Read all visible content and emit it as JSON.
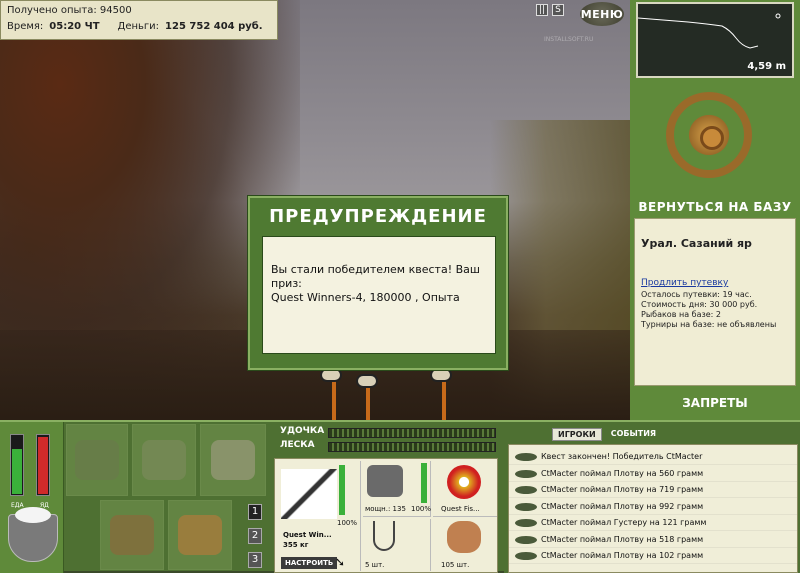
{
  "stats": {
    "experience_label": "Получено опыта: 94500",
    "time_label": "Время:",
    "time_value": "05:20 ЧТ",
    "money_label": "Деньги:",
    "money_value": "125 752 404 руб."
  },
  "top": {
    "pause_icon": "pause-icon",
    "sound_label": "S",
    "menu_label": "МЕНЮ",
    "watermark": "INSTALLSOFT.RU"
  },
  "depth": {
    "value": "4,59 m"
  },
  "right": {
    "back_label": "ВЕРНУТЬСЯ НА БАЗУ",
    "place": "Урал. Сазаний яр",
    "extend_link": "Продлить путевку",
    "remain": "Осталось путевки: 19 час.",
    "cost": "Стоимость дня: 30 000 руб.",
    "fishers": "Рыбаков на базе: 2",
    "tournaments": "Турниры на базе: не объявлены",
    "bans_label": "ЗАПРЕТЫ"
  },
  "modal": {
    "title": "ПРЕДУПРЕЖДЕНИЕ",
    "line1": "Вы стали победителем квеста! Ваш приз:",
    "line2": "Quest Winners-4, 180000 , Опыта"
  },
  "meters": {
    "food_label": "ЕДА",
    "poison_label": "ЯД",
    "food_level": 0.75,
    "poison_level": 0.95
  },
  "pages": [
    "1",
    "2",
    "3"
  ],
  "lines": {
    "rod_label": "УДОЧКА",
    "line_label": "ЛЕСКА"
  },
  "tackle": {
    "rod_name": "Quest Win...",
    "rod_weight": "355 кг",
    "rod_pct": "100%",
    "setup_label": "НАСТРОИТЬ",
    "reel_power": "мощн.: 135",
    "reel_pct": "100%",
    "line_name": "Quest Fis...",
    "hook_count": "5 шт.",
    "bait_count": "105 шт."
  },
  "feed": {
    "tab_players": "ИГРОКИ",
    "tab_events": "СОБЫТИЯ",
    "rows": [
      "Квест закончен! Победитель CtMacter",
      "CtMacter поймал Плотву на 560 грамм",
      "CtMacter поймал Плотву на 719 грамм",
      "CtMacter поймал Плотву на 992 грамм",
      "CtMacter поймал Густеру на 121 грамм",
      "CtMacter поймал Плотву на 518 грамм",
      "CtMacter поймал Плотву на 102 грамм"
    ]
  }
}
